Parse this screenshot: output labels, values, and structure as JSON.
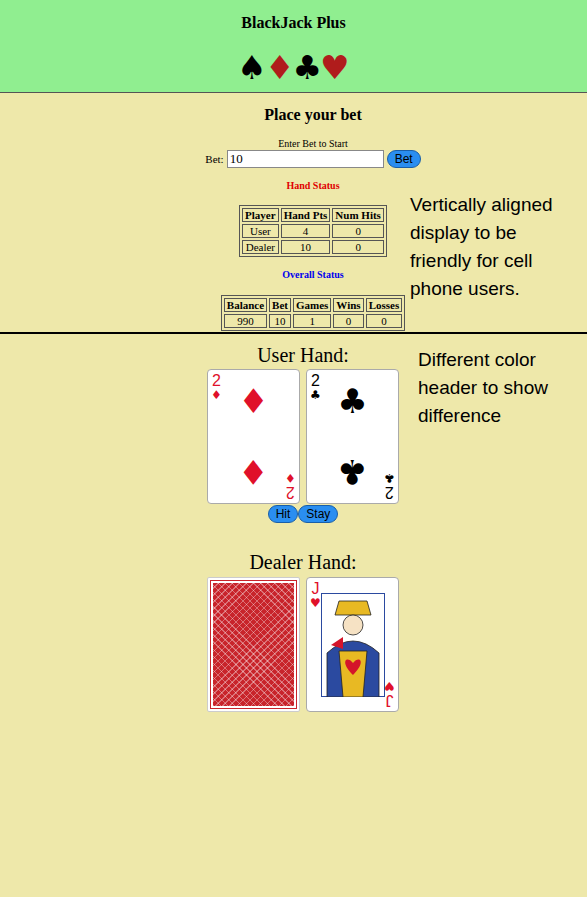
{
  "header": {
    "title": "BlackJack Plus",
    "suits": [
      {
        "symbol": "♠",
        "color": "#000000"
      },
      {
        "symbol": "♦",
        "color": "#b01c1c"
      },
      {
        "symbol": "♣",
        "color": "#000000"
      },
      {
        "symbol": "♥",
        "color": "#b01c1c"
      }
    ]
  },
  "bet_panel": {
    "title": "Place your bet",
    "hint": "Enter Bet to Start",
    "label": "Bet:",
    "value": "10",
    "button": "Bet"
  },
  "hand_status": {
    "title": "Hand Status",
    "columns": [
      "Player",
      "Hand Pts",
      "Num Hits"
    ],
    "rows": [
      [
        "User",
        "4",
        "0"
      ],
      [
        "Dealer",
        "10",
        "0"
      ]
    ]
  },
  "overall_status": {
    "title": "Overall Status",
    "columns": [
      "Balance",
      "Bet",
      "Games",
      "Wins",
      "Losses"
    ],
    "rows": [
      [
        "990",
        "10",
        "1",
        "0",
        "0"
      ]
    ]
  },
  "user_hand": {
    "title": "User Hand:",
    "cards": [
      {
        "rank": "2",
        "suit": "♦",
        "color": "#e0102a",
        "face_down": false
      },
      {
        "rank": "2",
        "suit": "♣",
        "color": "#000000",
        "face_down": false
      }
    ],
    "buttons": [
      "Hit",
      "Stay"
    ]
  },
  "dealer_hand": {
    "title": "Dealer Hand:",
    "cards": [
      {
        "face_down": true
      },
      {
        "rank": "J",
        "suit": "♥",
        "color": "#e0102a",
        "face_down": false
      }
    ]
  },
  "annotations": [
    "Vertically aligned display to be friendly for cell phone users.",
    "Different color header to show difference"
  ]
}
